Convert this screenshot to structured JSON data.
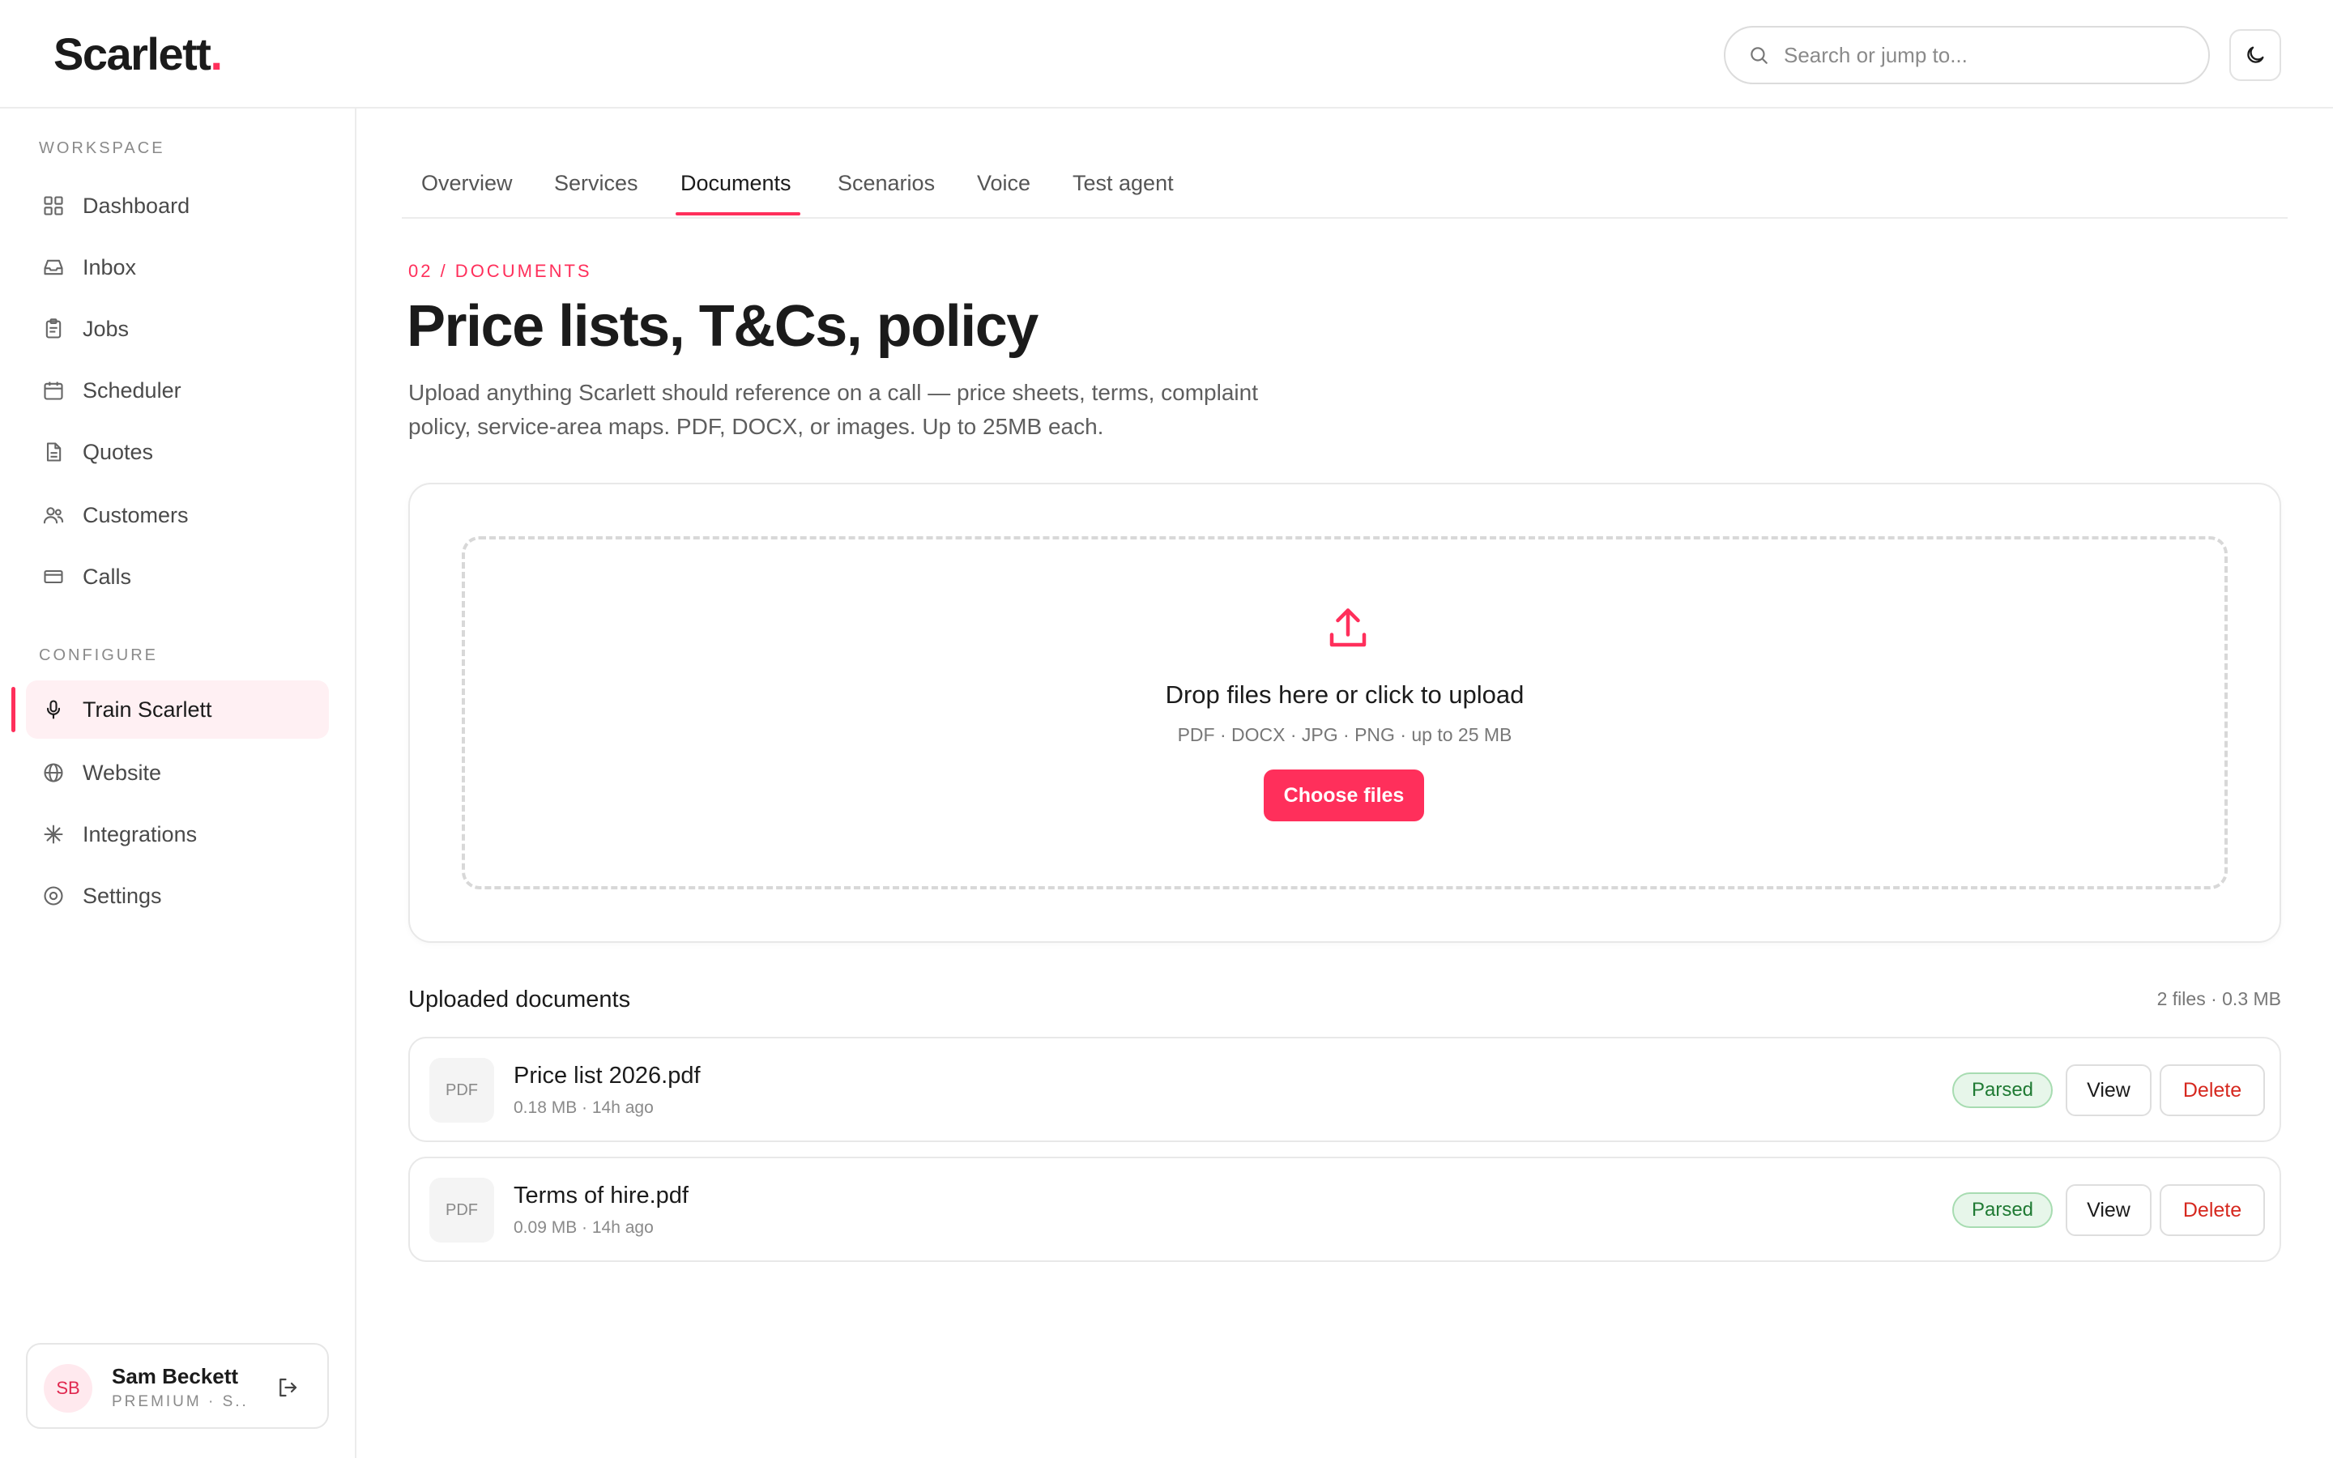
{
  "app": {
    "logo_text": "Scarlett",
    "logo_dot": ".",
    "brand_color": "#ff2f5b"
  },
  "header": {
    "search_placeholder": "Search or jump to...",
    "theme_toggle_icon": "moon-icon"
  },
  "sidebar": {
    "workspace_label": "WORKSPACE",
    "workspace_items": [
      {
        "label": "Dashboard",
        "icon": "grid-icon"
      },
      {
        "label": "Inbox",
        "icon": "inbox-icon"
      },
      {
        "label": "Jobs",
        "icon": "clipboard-icon"
      },
      {
        "label": "Scheduler",
        "icon": "calendar-icon"
      },
      {
        "label": "Quotes",
        "icon": "document-icon"
      },
      {
        "label": "Customers",
        "icon": "users-icon"
      },
      {
        "label": "Calls",
        "icon": "card-icon"
      }
    ],
    "configure_label": "CONFIGURE",
    "configure_items": [
      {
        "label": "Train Scarlett",
        "icon": "microphone-icon",
        "active": true
      },
      {
        "label": "Website",
        "icon": "globe-icon"
      },
      {
        "label": "Integrations",
        "icon": "sparkle-icon"
      },
      {
        "label": "Settings",
        "icon": "settings-icon"
      }
    ],
    "user": {
      "initials": "SB",
      "name": "Sam Beckett",
      "plan": "PREMIUM · S..."
    }
  },
  "tabs": [
    {
      "label": "Overview"
    },
    {
      "label": "Services"
    },
    {
      "label": "Documents",
      "active": true
    },
    {
      "label": "Scenarios"
    },
    {
      "label": "Voice"
    },
    {
      "label": "Test agent"
    }
  ],
  "main": {
    "eyebrow": "02 / DOCUMENTS",
    "title": "Price lists, T&Cs, policy",
    "description": "Upload anything Scarlett should reference on a call — price sheets, terms, complaint policy, service-area maps. PDF, DOCX, or images. Up to 25MB each.",
    "upload": {
      "title": "Drop files here or click to upload",
      "subtitle": "PDF · DOCX · JPG · PNG · up to 25 MB",
      "button": "Choose files"
    },
    "list_title": "Uploaded documents",
    "list_summary": "2 files · 0.3 MB",
    "documents": [
      {
        "type": "PDF",
        "name": "Price list 2026.pdf",
        "meta": "0.18 MB · 14h ago",
        "status": "Parsed",
        "view": "View",
        "delete": "Delete"
      },
      {
        "type": "PDF",
        "name": "Terms of hire.pdf",
        "meta": "0.09 MB · 14h ago",
        "status": "Parsed",
        "view": "View",
        "delete": "Delete"
      }
    ]
  }
}
